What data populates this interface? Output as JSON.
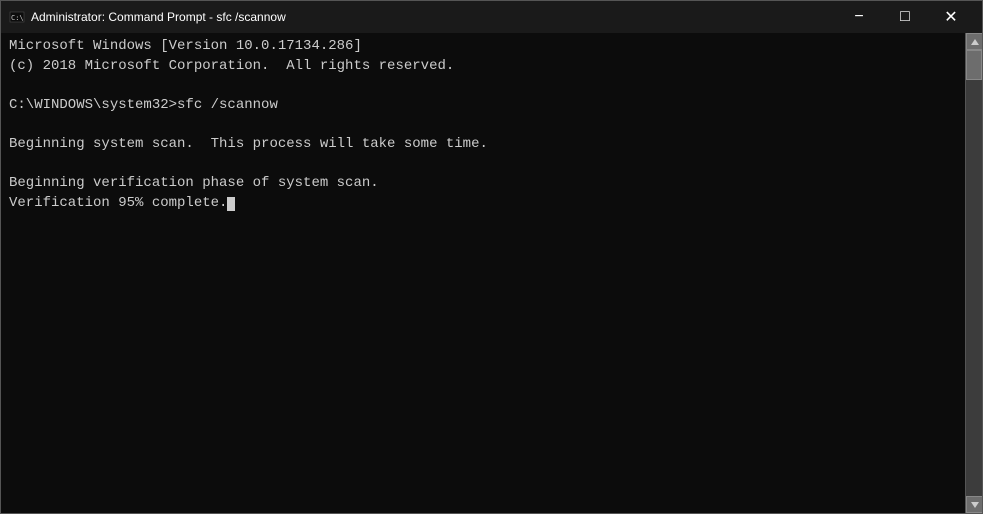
{
  "titleBar": {
    "icon": "cmd-icon",
    "title": "Administrator: Command Prompt - sfc /scannow",
    "minimizeLabel": "−",
    "maximizeLabel": "□",
    "closeLabel": "✕"
  },
  "console": {
    "lines": [
      "Microsoft Windows [Version 10.0.17134.286]",
      "(c) 2018 Microsoft Corporation.  All rights reserved.",
      "",
      "C:\\WINDOWS\\system32>sfc /scannow",
      "",
      "Beginning system scan.  This process will take some time.",
      "",
      "Beginning verification phase of system scan.",
      "Verification 95% complete."
    ]
  }
}
